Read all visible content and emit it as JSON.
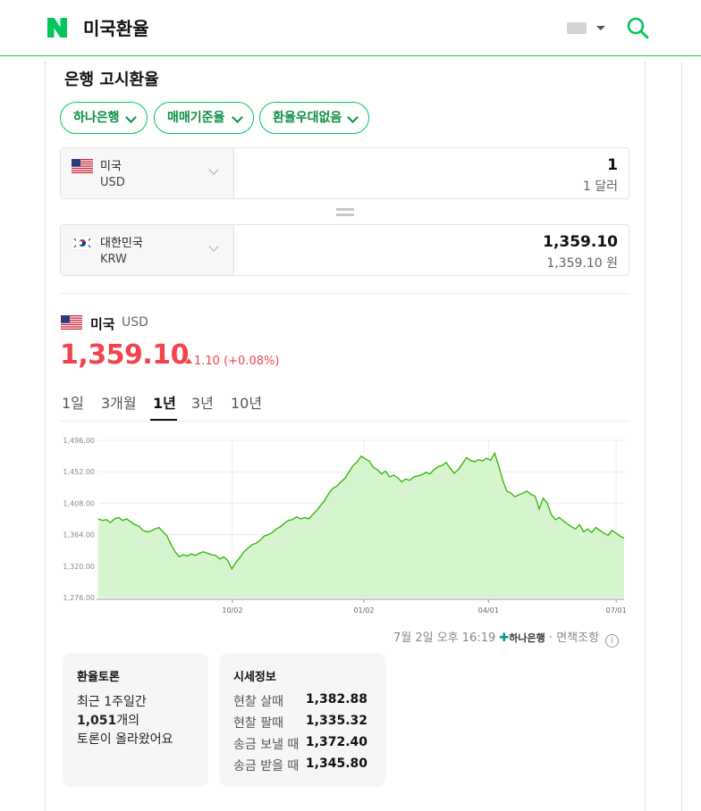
{
  "header": {
    "logo_letter": "N",
    "query": "미국환율",
    "brand_color": "#03c75a"
  },
  "section_title": "은행 고시환율",
  "filters": [
    {
      "label": "하나은행"
    },
    {
      "label": "매매기준율"
    },
    {
      "label": "환율우대없음"
    }
  ],
  "converter": {
    "from": {
      "country": "미국",
      "code": "USD",
      "amount": "1",
      "amount_text": "1 달러"
    },
    "to": {
      "country": "대한민국",
      "code": "KRW",
      "amount": "1,359.10",
      "amount_text": "1,359.10 원"
    }
  },
  "summary": {
    "country": "미국",
    "code": "USD",
    "price": "1,359.10",
    "change": "1.10 (+0.08%)",
    "direction": "up",
    "up_color": "#f0454d"
  },
  "period_tabs": [
    {
      "label": "1일",
      "active": false
    },
    {
      "label": "3개월",
      "active": false
    },
    {
      "label": "1년",
      "active": true
    },
    {
      "label": "3년",
      "active": false
    },
    {
      "label": "10년",
      "active": false
    }
  ],
  "chart_data": {
    "type": "area",
    "ylim": [
      1276,
      1496
    ],
    "y_ticks": [
      "1,496.00",
      "1,452.00",
      "1,408.00",
      "1,364.00",
      "1,320.00",
      "1,276.00"
    ],
    "x_ticks": [
      "10/02",
      "01/02",
      "04/01",
      "07/01"
    ],
    "line_color": "#2db400",
    "fill_color": "#d6f5cf",
    "grid": true,
    "series": [
      {
        "values": [
          1386,
          1384,
          1385,
          1381,
          1386,
          1388,
          1384,
          1386,
          1382,
          1378,
          1376,
          1370,
          1368,
          1369,
          1372,
          1374,
          1368,
          1362,
          1350,
          1340,
          1333,
          1336,
          1334,
          1337,
          1335,
          1338,
          1340,
          1338,
          1336,
          1335,
          1330,
          1333,
          1328,
          1316,
          1325,
          1332,
          1340,
          1345,
          1350,
          1352,
          1356,
          1362,
          1364,
          1367,
          1372,
          1375,
          1380,
          1384,
          1385,
          1389,
          1386,
          1388,
          1386,
          1392,
          1398,
          1405,
          1412,
          1422,
          1429,
          1432,
          1438,
          1443,
          1452,
          1461,
          1466,
          1474,
          1470,
          1467,
          1458,
          1455,
          1449,
          1453,
          1445,
          1447,
          1444,
          1438,
          1442,
          1440,
          1445,
          1446,
          1448,
          1451,
          1449,
          1455,
          1459,
          1461,
          1465,
          1457,
          1450,
          1455,
          1463,
          1472,
          1468,
          1466,
          1469,
          1467,
          1471,
          1468,
          1478,
          1460,
          1440,
          1425,
          1422,
          1417,
          1420,
          1422,
          1425,
          1420,
          1418,
          1400,
          1415,
          1408,
          1392,
          1385,
          1388,
          1383,
          1379,
          1375,
          1372,
          1378,
          1368,
          1372,
          1367,
          1374,
          1370,
          1366,
          1363,
          1370,
          1366,
          1362,
          1359
        ]
      }
    ]
  },
  "source": {
    "timestamp": "7월 2일 오후 16:19",
    "bank": "하나은행",
    "disclaimer": "면책조항"
  },
  "forum": {
    "title": "환율토론",
    "line1": "최근 1주일간",
    "count": "1,051",
    "count_suffix": "개의",
    "line3": "토론이 올라왔어요"
  },
  "market_info": {
    "title": "시세정보",
    "rows": [
      {
        "label": "현찰 살때",
        "value": "1,382.88"
      },
      {
        "label": "현찰 팔때",
        "value": "1,335.32"
      },
      {
        "label": "송금 보낼 때",
        "value": "1,372.40"
      },
      {
        "label": "송금 받을 때",
        "value": "1,345.80"
      }
    ]
  }
}
